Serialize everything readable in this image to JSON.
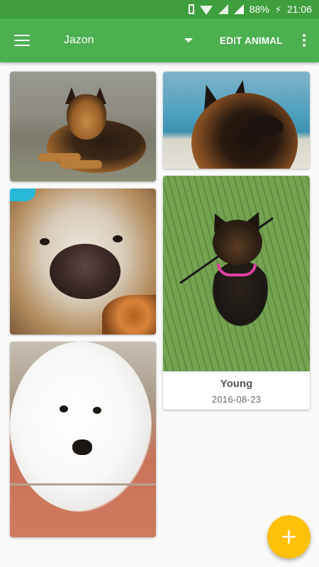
{
  "status_bar": {
    "battery": "88%",
    "time": "21:06",
    "icons": [
      "vibrate-icon",
      "wifi-icon",
      "no-data-icon",
      "signal-icon",
      "battery-charging-icon"
    ]
  },
  "app_bar": {
    "title": "Jazon",
    "edit_label": "EDIT ANIMAL",
    "icons": [
      "menu-icon",
      "dropdown-arrow-icon",
      "more-vert-icon"
    ]
  },
  "gallery": {
    "featured": {
      "name": "Young",
      "date": "2016-08-23"
    }
  },
  "fab": {
    "label": "+"
  },
  "colors": {
    "status_bar": "#3f9e3e",
    "app_bar": "#4caf50",
    "fab": "#ffc107",
    "background": "#fafafa"
  }
}
